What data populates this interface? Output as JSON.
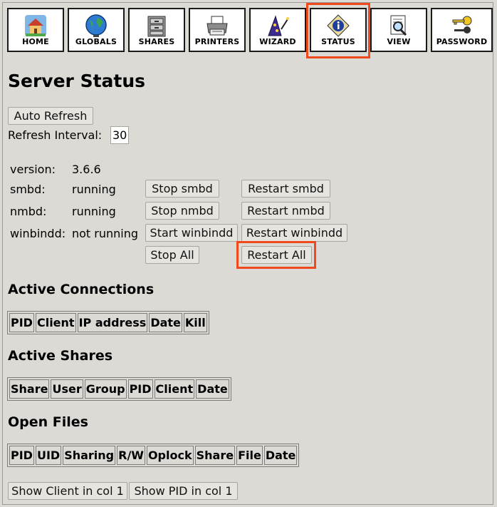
{
  "toolbar": {
    "items": [
      {
        "label": "HOME",
        "icon": "house-icon"
      },
      {
        "label": "GLOBALS",
        "icon": "globe-icon"
      },
      {
        "label": "SHARES",
        "icon": "file-cabinet-icon"
      },
      {
        "label": "PRINTERS",
        "icon": "printer-icon"
      },
      {
        "label": "WIZARD",
        "icon": "wizard-hat-icon"
      },
      {
        "label": "STATUS",
        "icon": "info-icon"
      },
      {
        "label": "VIEW",
        "icon": "magnifier-icon"
      },
      {
        "label": "PASSWORD",
        "icon": "keys-icon"
      }
    ]
  },
  "page": {
    "title": "Server Status",
    "auto_refresh": "Auto Refresh",
    "refresh_interval_label": "Refresh Interval:",
    "refresh_interval_value": "30"
  },
  "services": {
    "version_label": "version:",
    "version_value": "3.6.6",
    "smbd_label": "smbd:",
    "smbd_status": "running",
    "smbd_stop": "Stop smbd",
    "smbd_restart": "Restart smbd",
    "nmbd_label": "nmbd:",
    "nmbd_status": "running",
    "nmbd_stop": "Stop nmbd",
    "nmbd_restart": "Restart nmbd",
    "winbindd_label": "winbindd:",
    "winbindd_status": "not running",
    "winbindd_start": "Start winbindd",
    "winbindd_restart": "Restart winbindd",
    "stop_all": "Stop All",
    "restart_all": "Restart All"
  },
  "connections": {
    "title": "Active Connections",
    "columns": [
      "PID",
      "Client",
      "IP address",
      "Date",
      "Kill"
    ]
  },
  "shares": {
    "title": "Active Shares",
    "columns": [
      "Share",
      "User",
      "Group",
      "PID",
      "Client",
      "Date"
    ]
  },
  "files": {
    "title": "Open Files",
    "columns": [
      "PID",
      "UID",
      "Sharing",
      "R/W",
      "Oplock",
      "Share",
      "File",
      "Date"
    ]
  },
  "footer": {
    "show_client": "Show Client in col 1",
    "show_pid": "Show PID in col 1"
  },
  "colors": {
    "background": "#dcdad5",
    "highlight": "#f0491d"
  }
}
